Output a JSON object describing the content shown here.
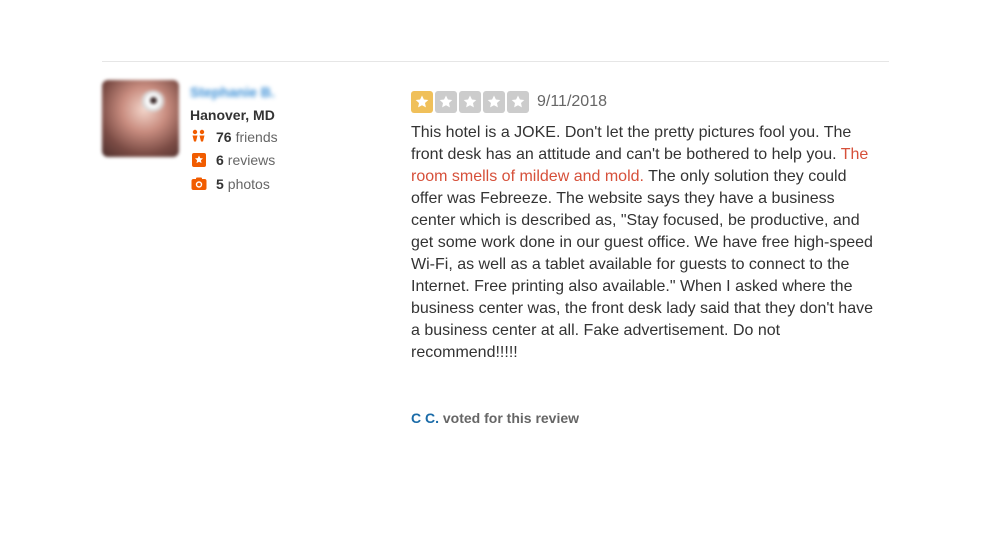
{
  "reviewer": {
    "name": "Stephanie B.",
    "location": "Hanover, MD",
    "friends_count": "76",
    "friends_label": "friends",
    "reviews_count": "6",
    "reviews_label": "reviews",
    "photos_count": "5",
    "photos_label": "photos"
  },
  "review": {
    "rating": 1,
    "max_rating": 5,
    "date": "9/11/2018",
    "text_part1": "This hotel is a JOKE. Don't let the pretty pictures fool you. The front desk has an attitude and can't be bothered to help you. ",
    "text_highlight": "The room smells of mildew and mold.",
    "text_part2": " The only solution they could offer was Febreeze. The website says they have a business center which is described as, \"Stay focused, be productive, and get some work done in our guest office. We have free high-speed Wi-Fi, as well as a tablet available for guests to connect to the Internet. Free printing also available.\" When I asked where the business center was, the front desk lady said that they don't have a business center at all. Fake advertisement. Do not recommend!!!!!"
  },
  "votes": {
    "voter": "C C.",
    "label": " voted for this review"
  },
  "colors": {
    "star_active": "#f0c05a",
    "star_inactive": "#cccccc",
    "highlight": "#d6503a",
    "link": "#1a6ba8",
    "stat_icon": "#f15c00"
  },
  "icons": [
    "friends-icon",
    "review-star-icon",
    "camera-icon",
    "star-icon"
  ]
}
